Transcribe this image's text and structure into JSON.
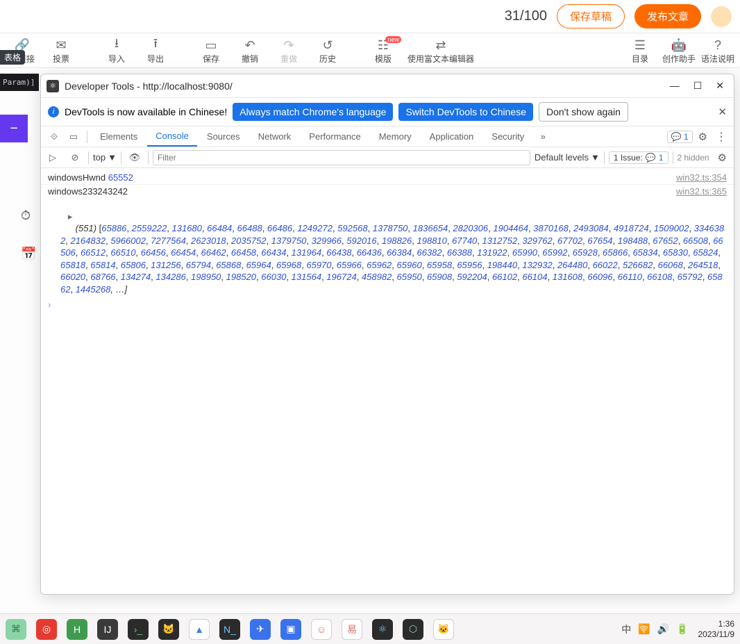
{
  "topbar": {
    "counter": "31/100",
    "save_draft": "保存草稿",
    "publish": "发布文章"
  },
  "left_tag": "表格",
  "left_code_snippet": "Param)]",
  "toolbar": {
    "hyperlink": "超链接",
    "vote": "投票",
    "import": "导入",
    "export": "导出",
    "save": "保存",
    "undo": "撤销",
    "redo": "重做",
    "history": "历史",
    "template": "模版",
    "rich_editor": "使用富文本编辑器",
    "toc": "目录",
    "assistant": "创作助手",
    "syntax": "语法说明",
    "new_badge": "new"
  },
  "devtools": {
    "title": "Developer Tools - http://localhost:9080/",
    "lang_msg": "DevTools is now available in Chinese!",
    "lang_match": "Always match Chrome's language",
    "lang_switch": "Switch DevTools to Chinese",
    "lang_dont": "Don't show again",
    "tabs": {
      "elements": "Elements",
      "console": "Console",
      "sources": "Sources",
      "network": "Network",
      "performance": "Performance",
      "memory": "Memory",
      "application": "Application",
      "security": "Security"
    },
    "msg_badge_count": "1",
    "console_toolbar": {
      "context": "top",
      "filter_placeholder": "Filter",
      "default_levels": "Default levels",
      "issues_label": "1 Issue:",
      "issues_count": "1",
      "hidden": "2 hidden"
    },
    "log1": {
      "label": "windowsHwnd",
      "value": "65552",
      "source": "win32.ts:354"
    },
    "log2": {
      "label": "windows233243242",
      "source": "win32.ts:365",
      "count_prefix": "(551)",
      "values": [
        65886,
        2559222,
        131680,
        66484,
        66488,
        66486,
        1249272,
        592568,
        1378750,
        1836654,
        2820306,
        1904464,
        3870168,
        2493084,
        4918724,
        1509002,
        3346382,
        2164832,
        5966002,
        7277564,
        2623018,
        2035752,
        1379750,
        329966,
        592016,
        198826,
        198810,
        67740,
        1312752,
        329762,
        67702,
        67654,
        198488,
        67652,
        66508,
        66506,
        66512,
        66510,
        66456,
        66454,
        66462,
        66458,
        66434,
        131964,
        66438,
        66436,
        66384,
        66382,
        66388,
        131922,
        65990,
        65992,
        65928,
        65866,
        65834,
        65830,
        65824,
        65818,
        65814,
        65806,
        131256,
        65794,
        65868,
        65964,
        65968,
        65970,
        65966,
        65962,
        65960,
        65958,
        65956,
        198440,
        132932,
        264480,
        66022,
        526682,
        66068,
        264518,
        66020,
        68766,
        134274,
        134286,
        198950,
        198520,
        66030,
        131564,
        196724,
        458982,
        65950,
        65908,
        592204,
        66102,
        66104,
        131608,
        66096,
        66110,
        66108,
        65792,
        65862,
        1445268
      ]
    }
  },
  "taskbar": {
    "ime": "中",
    "time": "1:36",
    "date": "2023/11/9"
  }
}
